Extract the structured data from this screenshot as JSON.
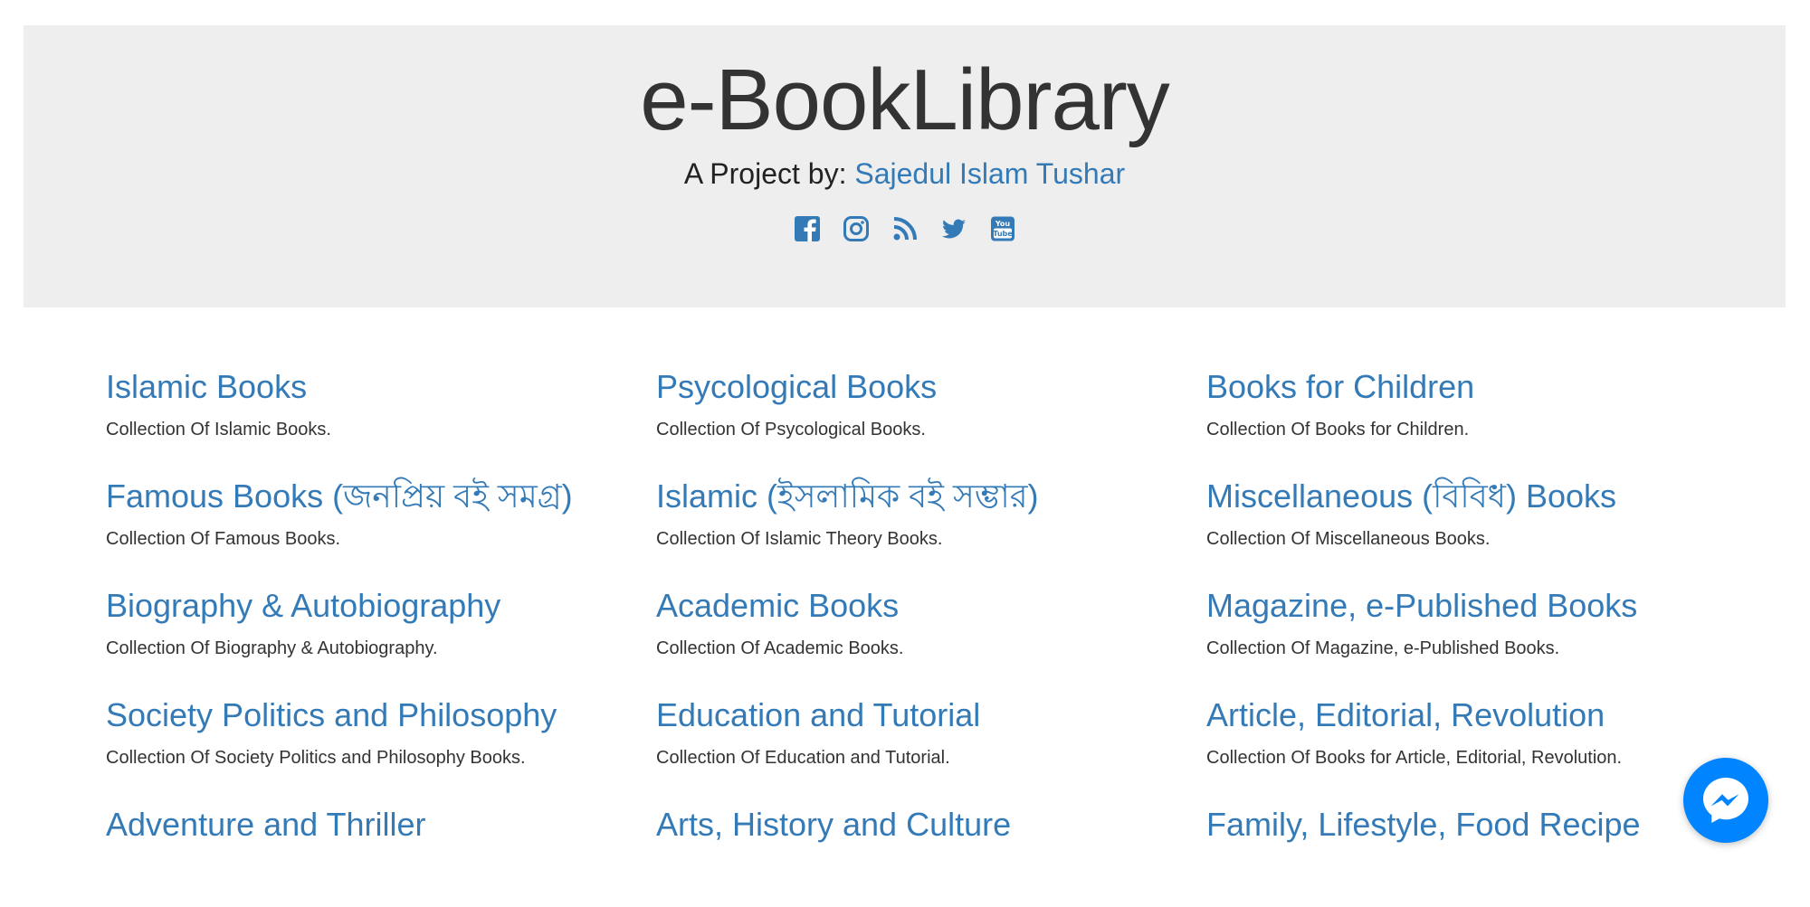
{
  "header": {
    "title": "e-BookLibrary",
    "byline_prefix": "A Project by:",
    "author": "Sajedul Islam Tushar",
    "social_icons": [
      "facebook-icon",
      "instagram-icon",
      "rss-icon",
      "twitter-icon",
      "youtube-icon"
    ]
  },
  "categories": [
    {
      "title": "Islamic Books",
      "desc": "Collection Of Islamic Books."
    },
    {
      "title": "Psycological Books",
      "desc": "Collection Of Psycological Books."
    },
    {
      "title": "Books for Children",
      "desc": "Collection Of Books for Children."
    },
    {
      "title": "Famous Books (জনপ্রিয় বই সমগ্র)",
      "desc": "Collection Of Famous Books."
    },
    {
      "title": "Islamic (ইসলামিক বই সম্ভার)",
      "desc": "Collection Of Islamic Theory Books."
    },
    {
      "title": "Miscellaneous (বিবিধ) Books",
      "desc": "Collection Of Miscellaneous Books."
    },
    {
      "title": "Biography & Autobiography",
      "desc": "Collection Of Biography & Autobiography."
    },
    {
      "title": "Academic Books",
      "desc": "Collection Of Academic Books."
    },
    {
      "title": "Magazine, e-Published Books",
      "desc": "Collection Of Magazine, e-Published Books."
    },
    {
      "title": "Society Politics and Philosophy",
      "desc": "Collection Of Society Politics and Philosophy Books."
    },
    {
      "title": "Education and Tutorial",
      "desc": "Collection Of Education and Tutorial."
    },
    {
      "title": "Article, Editorial, Revolution",
      "desc": "Collection Of Books for Article, Editorial, Revolution."
    },
    {
      "title": "Adventure and Thriller",
      "desc": ""
    },
    {
      "title": "Arts, History and Culture",
      "desc": ""
    },
    {
      "title": "Family, Lifestyle, Food Recipe",
      "desc": ""
    }
  ],
  "colors": {
    "link": "#337ab7",
    "jumbotron_bg": "#eeeeee",
    "messenger": "#0084ff"
  }
}
